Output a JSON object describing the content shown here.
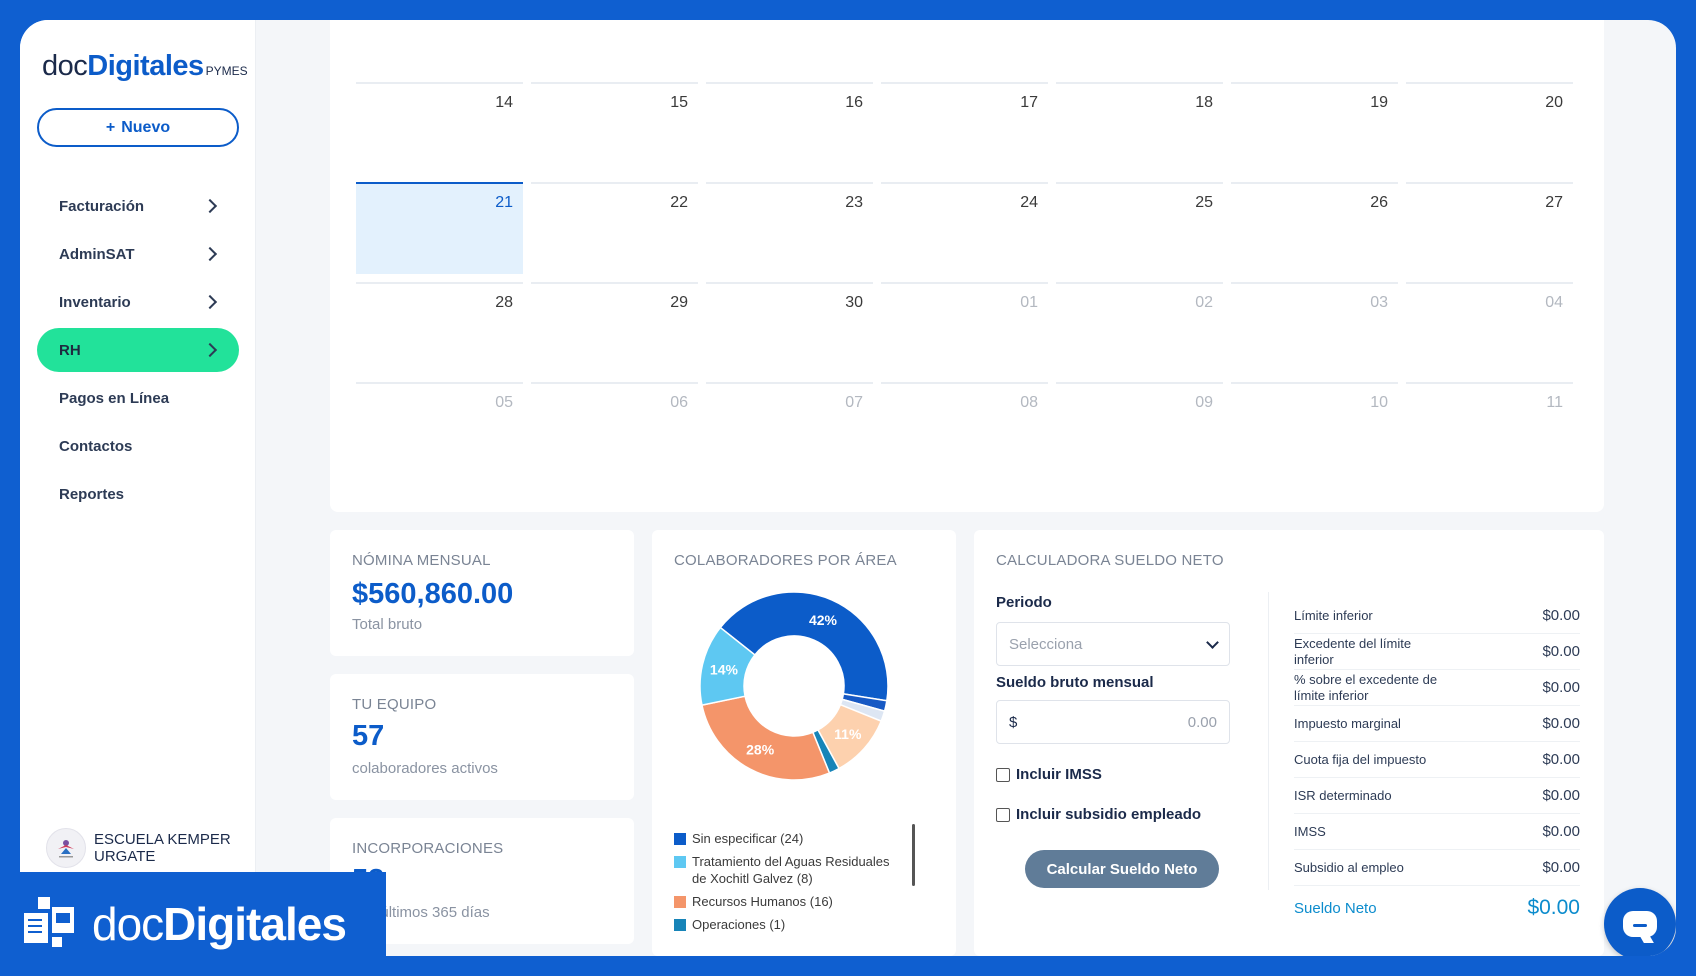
{
  "sidebar": {
    "logo": {
      "doc": "doc",
      "digitales": "Digitales",
      "suffix": "PYMES"
    },
    "new_button": {
      "icon": "plus-icon",
      "label": "Nuevo"
    },
    "items": [
      {
        "label": "Facturación",
        "has_chevron": true,
        "active": false
      },
      {
        "label": "AdminSAT",
        "has_chevron": true,
        "active": false
      },
      {
        "label": "Inventario",
        "has_chevron": true,
        "active": false
      },
      {
        "label": "RH",
        "has_chevron": true,
        "active": true
      },
      {
        "label": "Pagos en Línea",
        "has_chevron": false,
        "active": false
      },
      {
        "label": "Contactos",
        "has_chevron": false,
        "active": false
      },
      {
        "label": "Reportes",
        "has_chevron": false,
        "active": false
      }
    ],
    "org": {
      "name": "ESCUELA KEMPER URGATE",
      "avatar_icon": "school-logo-icon"
    }
  },
  "calendar": {
    "weeks": [
      [
        {
          "d": "14"
        },
        {
          "d": "15"
        },
        {
          "d": "16"
        },
        {
          "d": "17"
        },
        {
          "d": "18"
        },
        {
          "d": "19"
        },
        {
          "d": "20"
        }
      ],
      [
        {
          "d": "21",
          "today": true
        },
        {
          "d": "22"
        },
        {
          "d": "23"
        },
        {
          "d": "24"
        },
        {
          "d": "25"
        },
        {
          "d": "26"
        },
        {
          "d": "27"
        }
      ],
      [
        {
          "d": "28"
        },
        {
          "d": "29"
        },
        {
          "d": "30"
        },
        {
          "d": "01",
          "muted": true
        },
        {
          "d": "02",
          "muted": true
        },
        {
          "d": "03",
          "muted": true
        },
        {
          "d": "04",
          "muted": true
        }
      ],
      [
        {
          "d": "05",
          "muted": true
        },
        {
          "d": "06",
          "muted": true
        },
        {
          "d": "07",
          "muted": true
        },
        {
          "d": "08",
          "muted": true
        },
        {
          "d": "09",
          "muted": true
        },
        {
          "d": "10",
          "muted": true
        },
        {
          "d": "11",
          "muted": true
        }
      ]
    ]
  },
  "nomina": {
    "title": "NÓMINA MENSUAL",
    "amount": "$560,860.00",
    "caption": "Total bruto"
  },
  "equipo": {
    "title": "TU EQUIPO",
    "count": "57",
    "caption": "colaboradores activos"
  },
  "incorporaciones": {
    "title": "INCORPORACIONES",
    "count": "53",
    "caption": "Los últimos 365 días"
  },
  "colaboradores": {
    "title": "COLABORADORES POR ÁREA",
    "legend": [
      {
        "label": "Sin especificar (24)",
        "color": "#0c5cc9"
      },
      {
        "label": "Tratamiento del Aguas Residuales de Xochitl Galvez (8)",
        "color": "#5ec8f2"
      },
      {
        "label": "Recursos Humanos (16)",
        "color": "#f4956a"
      },
      {
        "label": "Operaciones (1)",
        "color": "#1784b8"
      }
    ]
  },
  "chart_data": {
    "type": "pie",
    "title": "COLABORADORES POR ÁREA",
    "donut": true,
    "slices": [
      {
        "label": "42%",
        "value": 42,
        "color": "#0c5cc9"
      },
      {
        "label": "",
        "value": 1.8,
        "color": "#1759c4"
      },
      {
        "label": "",
        "value": 1.8,
        "color": "#dde6f3"
      },
      {
        "label": "11%",
        "value": 11,
        "color": "#fdd1ae"
      },
      {
        "label": "",
        "value": 1.8,
        "color": "#1784b8"
      },
      {
        "label": "28%",
        "value": 28,
        "color": "#f4956a"
      },
      {
        "label": "14%",
        "value": 14,
        "color": "#5ec8f2"
      }
    ]
  },
  "calculadora": {
    "title": "CALCULADORA SUELDO NETO",
    "periodo_label": "Periodo",
    "periodo_placeholder": "Selecciona",
    "sueldo_label": "Sueldo bruto mensual",
    "currency": "$",
    "sueldo_value": "0.00",
    "incluir_imss": "Incluir IMSS",
    "incluir_subsidio": "Incluir subsidio empleado",
    "button": "Calcular Sueldo Neto",
    "results": [
      {
        "label": "Límite inferior",
        "value": "$0.00"
      },
      {
        "label": "Excedente del límite inferior",
        "value": "$0.00"
      },
      {
        "label": "% sobre el excedente de límite inferior",
        "value": "$0.00"
      },
      {
        "label": "Impuesto marginal",
        "value": "$0.00"
      },
      {
        "label": "Cuota fija del impuesto",
        "value": "$0.00"
      },
      {
        "label": "ISR determinado",
        "value": "$0.00"
      },
      {
        "label": "IMSS",
        "value": "$0.00"
      },
      {
        "label": "Subsidio al empleo",
        "value": "$0.00"
      }
    ],
    "neto_label": "Sueldo Neto",
    "neto_value": "$0.00"
  },
  "chat": {
    "icon": "chat-icon"
  },
  "watermark": {
    "doc": "doc",
    "digitales": "Digitales",
    "icon": "document-stack-icon"
  }
}
